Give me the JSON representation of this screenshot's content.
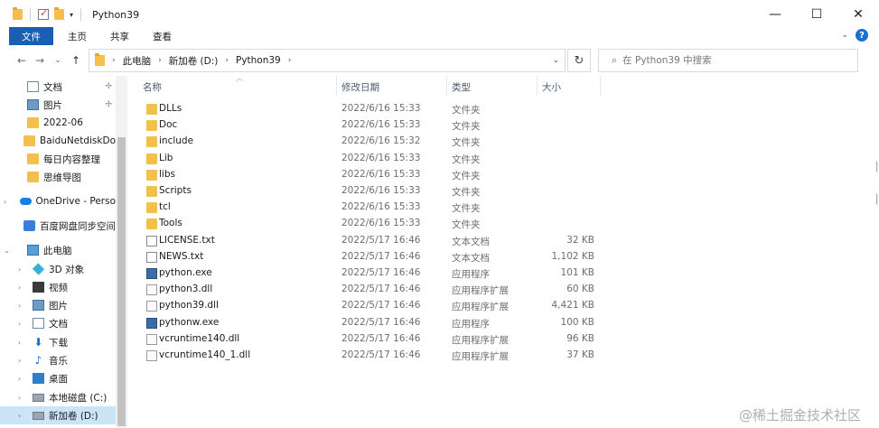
{
  "window": {
    "title": "Python39",
    "minimize": "—",
    "maximize": "☐",
    "close": "✕"
  },
  "ribbon": {
    "tabs": [
      "文件",
      "主页",
      "共享",
      "查看"
    ],
    "collapse": "⌄",
    "help": "?"
  },
  "nav": {
    "back": "←",
    "forward": "→",
    "recent": "⌄",
    "up": "↑",
    "refresh": "↻"
  },
  "address": {
    "crumbs": [
      "此电脑",
      "新加卷 (D:)",
      "Python39"
    ]
  },
  "search": {
    "placeholder": "在 Python39 中搜索"
  },
  "sidebar": {
    "items": [
      {
        "label": "文档",
        "icon": "document-icon",
        "pinned": true
      },
      {
        "label": "图片",
        "icon": "picture-icon",
        "pinned": true
      },
      {
        "label": "2022-06",
        "icon": "folder-icon"
      },
      {
        "label": "BaiduNetdiskDo",
        "icon": "folder-icon"
      },
      {
        "label": "每日内容整理",
        "icon": "folder-icon"
      },
      {
        "label": "思维导图",
        "icon": "folder-icon"
      },
      {
        "label": "OneDrive - Perso",
        "icon": "onedrive-icon",
        "expandable": true
      },
      {
        "label": "百度网盘同步空间",
        "icon": "baidu-sync-icon"
      },
      {
        "label": "此电脑",
        "icon": "computer-icon",
        "expanded": true
      },
      {
        "label": "3D 对象",
        "icon": "3d-objects-icon",
        "expandable": true
      },
      {
        "label": "视频",
        "icon": "video-icon",
        "expandable": true
      },
      {
        "label": "图片",
        "icon": "picture-icon",
        "expandable": true
      },
      {
        "label": "文档",
        "icon": "document-icon",
        "expandable": true
      },
      {
        "label": "下载",
        "icon": "download-icon",
        "expandable": true
      },
      {
        "label": "音乐",
        "icon": "music-icon",
        "expandable": true
      },
      {
        "label": "桌面",
        "icon": "desktop-icon",
        "expandable": true
      },
      {
        "label": "本地磁盘 (C:)",
        "icon": "drive-icon",
        "expandable": true
      },
      {
        "label": "新加卷 (D:)",
        "icon": "drive-icon",
        "expandable": true,
        "selected": true
      }
    ]
  },
  "columns": {
    "name": "名称",
    "date": "修改日期",
    "type": "类型",
    "size": "大小"
  },
  "files": [
    {
      "name": "DLLs",
      "date": "2022/6/16 15:33",
      "type": "文件夹",
      "size": "",
      "kind": "folder"
    },
    {
      "name": "Doc",
      "date": "2022/6/16 15:33",
      "type": "文件夹",
      "size": "",
      "kind": "folder"
    },
    {
      "name": "include",
      "date": "2022/6/16 15:32",
      "type": "文件夹",
      "size": "",
      "kind": "folder"
    },
    {
      "name": "Lib",
      "date": "2022/6/16 15:33",
      "type": "文件夹",
      "size": "",
      "kind": "folder"
    },
    {
      "name": "libs",
      "date": "2022/6/16 15:33",
      "type": "文件夹",
      "size": "",
      "kind": "folder"
    },
    {
      "name": "Scripts",
      "date": "2022/6/16 15:33",
      "type": "文件夹",
      "size": "",
      "kind": "folder"
    },
    {
      "name": "tcl",
      "date": "2022/6/16 15:33",
      "type": "文件夹",
      "size": "",
      "kind": "folder"
    },
    {
      "name": "Tools",
      "date": "2022/6/16 15:33",
      "type": "文件夹",
      "size": "",
      "kind": "folder"
    },
    {
      "name": "LICENSE.txt",
      "date": "2022/5/17 16:46",
      "type": "文本文档",
      "size": "32 KB",
      "kind": "txt"
    },
    {
      "name": "NEWS.txt",
      "date": "2022/5/17 16:46",
      "type": "文本文档",
      "size": "1,102 KB",
      "kind": "txt"
    },
    {
      "name": "python.exe",
      "date": "2022/5/17 16:46",
      "type": "应用程序",
      "size": "101 KB",
      "kind": "exe"
    },
    {
      "name": "python3.dll",
      "date": "2022/5/17 16:46",
      "type": "应用程序扩展",
      "size": "60 KB",
      "kind": "dll"
    },
    {
      "name": "python39.dll",
      "date": "2022/5/17 16:46",
      "type": "应用程序扩展",
      "size": "4,421 KB",
      "kind": "dll"
    },
    {
      "name": "pythonw.exe",
      "date": "2022/5/17 16:46",
      "type": "应用程序",
      "size": "100 KB",
      "kind": "exe"
    },
    {
      "name": "vcruntime140.dll",
      "date": "2022/5/17 16:46",
      "type": "应用程序扩展",
      "size": "96 KB",
      "kind": "dll"
    },
    {
      "name": "vcruntime140_1.dll",
      "date": "2022/5/17 16:46",
      "type": "应用程序扩展",
      "size": "37 KB",
      "kind": "dll"
    }
  ],
  "watermark": "@稀土掘金技术社区"
}
